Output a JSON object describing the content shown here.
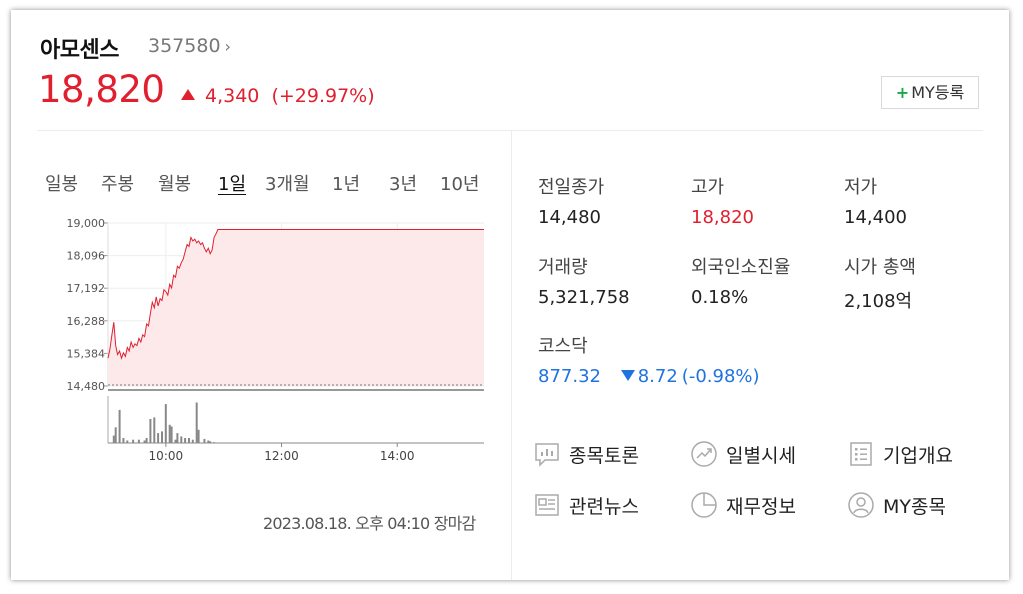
{
  "stock": {
    "name": "아모센스",
    "code": "357580",
    "code_chevron": "›",
    "price": "18,820",
    "change_amount": "4,340",
    "change_percent": "(+29.97%)",
    "direction": "up",
    "my_button": {
      "plus": "+",
      "label": "MY등록"
    }
  },
  "periods": [
    "일봉",
    "주봉",
    "월봉",
    "1일",
    "3개월",
    "1년",
    "3년",
    "10년"
  ],
  "active_period": "1일",
  "chart_data": {
    "type": "area",
    "title": "",
    "xlabel": "",
    "ylabel": "",
    "ylim": [
      14480,
      19000
    ],
    "y_ticks": [
      "19,000",
      "18,096",
      "17,192",
      "16,288",
      "15,384",
      "14,480"
    ],
    "x_ticks": [
      "10:00",
      "12:00",
      "14:00"
    ],
    "x_range_minutes": [
      540,
      930
    ],
    "reference_value": 14480,
    "series": [
      {
        "x": [
          540,
          542,
          544,
          546,
          548,
          550,
          552,
          554,
          556,
          558,
          560,
          562,
          564,
          566,
          568,
          570,
          572,
          574,
          576,
          578,
          580,
          582,
          584,
          586,
          588,
          590,
          592,
          594,
          596,
          598,
          600,
          602,
          604,
          606,
          608,
          610,
          612,
          614,
          616,
          618,
          620,
          622,
          624,
          626,
          628,
          630,
          632,
          634,
          636,
          638,
          640,
          642,
          644,
          646,
          648,
          650,
          652,
          654,
          656,
          658,
          660,
          662,
          664,
          666,
          668,
          670,
          672,
          674,
          676,
          678,
          680,
          930
        ],
        "values": [
          15250,
          15500,
          15900,
          16250,
          15600,
          15350,
          15450,
          15250,
          15400,
          15300,
          15550,
          15450,
          15700,
          15550,
          15650,
          15600,
          15800,
          15700,
          15900,
          15850,
          16200,
          16150,
          16500,
          16800,
          16650,
          16950,
          16700,
          16900,
          16850,
          17150,
          17100,
          17000,
          17300,
          17200,
          17550,
          17500,
          17800,
          17750,
          17900,
          18000,
          18200,
          18400,
          18350,
          18600,
          18500,
          18550,
          18450,
          18500,
          18400,
          18450,
          18300,
          18200,
          18300,
          18150,
          18250,
          18600,
          18700,
          18820,
          18820,
          18820,
          18820,
          18820,
          18820,
          18820,
          18820,
          18820,
          18820,
          18820,
          18820,
          18820,
          18820,
          18820
        ]
      }
    ],
    "volume": {
      "x": [
        546,
        548,
        552,
        556,
        560,
        566,
        572,
        578,
        580,
        584,
        588,
        592,
        596,
        600,
        604,
        606,
        610,
        612,
        616,
        620,
        624,
        628,
        632,
        634,
        640,
        644,
        646,
        650
      ],
      "values": [
        0.45,
        0.95,
        2.0,
        0.3,
        0.15,
        0.2,
        0.2,
        0.15,
        0.3,
        1.45,
        1.55,
        0.6,
        0.7,
        2.35,
        1.1,
        1.0,
        0.2,
        0.6,
        0.4,
        0.3,
        0.3,
        0.2,
        2.45,
        0.8,
        0.25,
        0.15,
        0.1,
        0.05
      ]
    }
  },
  "timestamp": "2023.08.18. 오후 04:10 장마감",
  "stats": [
    {
      "label": "전일종가",
      "value": "14,480",
      "color": "#222222"
    },
    {
      "label": "고가",
      "value": "18,820",
      "color": "#e0202f"
    },
    {
      "label": "저가",
      "value": "14,400",
      "color": "#222222"
    },
    {
      "label": "거래량",
      "value": "5,321,758",
      "color": "#222222"
    },
    {
      "label": "외국인소진율",
      "value": "0.18%",
      "color": "#222222"
    },
    {
      "label": "시가 총액",
      "value": "2,108억",
      "color": "#222222"
    }
  ],
  "kosdaq": {
    "label": "코스닥",
    "value": "877.32",
    "change": "8.72",
    "change_percent": "(-0.98%)",
    "color": "#1f73e0"
  },
  "links": [
    {
      "label": "종목토론",
      "icon": "chart-board-icon"
    },
    {
      "label": "일별시세",
      "icon": "trend-circle-icon"
    },
    {
      "label": "기업개요",
      "icon": "list-document-icon"
    },
    {
      "label": "관련뉴스",
      "icon": "news-icon"
    },
    {
      "label": "재무정보",
      "icon": "pie-chart-icon"
    },
    {
      "label": "MY종목",
      "icon": "user-icon"
    }
  ],
  "colors": {
    "up": "#e0202f",
    "down": "#1f73e0",
    "accent_green": "#1aa84a",
    "area_fill": "#fde8ea"
  }
}
